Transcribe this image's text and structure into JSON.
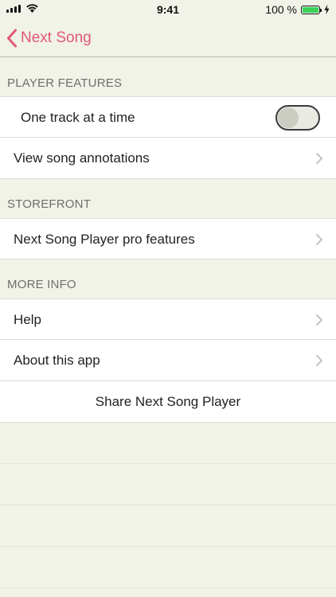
{
  "status_bar": {
    "time": "9:41",
    "battery_label": "100 %",
    "battery_level": 1.0,
    "battery_color": "#3bd15a"
  },
  "nav": {
    "back_label": "Next Song",
    "accent": "#e05a73"
  },
  "sections": {
    "player_features": {
      "header": "PLAYER FEATURES",
      "one_track": "One track at a time",
      "one_track_toggle_on": false,
      "annotations": "View song annotations"
    },
    "storefront": {
      "header": "STOREFRONT",
      "pro_features": "Next Song Player pro features"
    },
    "more_info": {
      "header": "MORE INFO",
      "help": "Help",
      "about": "About this app",
      "share": "Share Next Song Player"
    }
  },
  "icons": {
    "back": "chevron-left-icon",
    "disclosure": "chevron-right-icon",
    "signal": "cellular-signal-icon",
    "wifi": "wifi-icon",
    "battery": "battery-icon",
    "charging": "charging-bolt-icon"
  }
}
